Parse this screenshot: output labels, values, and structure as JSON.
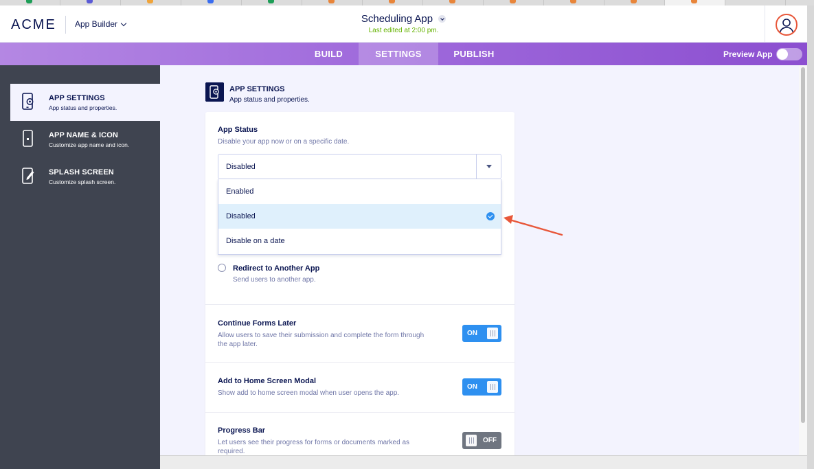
{
  "colors": {
    "navy": "#0a1551",
    "accent_blue": "#2e90f0",
    "edited_green": "#64b200",
    "nav_purple": "#a06bdc",
    "sidebar_bg": "#3f4450",
    "arrow_red": "#e8573a"
  },
  "header": {
    "logo": "ACME",
    "app_builder_label": "App Builder",
    "app_title": "Scheduling App",
    "last_edited": "Last edited at 2:00 pm.",
    "avatar_icon": "user-avatar-icon"
  },
  "nav": {
    "tabs": [
      {
        "label": "BUILD",
        "active": false
      },
      {
        "label": "SETTINGS",
        "active": true
      },
      {
        "label": "PUBLISH",
        "active": false
      }
    ],
    "preview_label": "Preview App",
    "preview_on": false
  },
  "sidebar": {
    "items": [
      {
        "label": "APP SETTINGS",
        "sub": "App status and properties.",
        "icon": "phone-gear-icon",
        "active": true
      },
      {
        "label": "APP NAME & ICON",
        "sub": "Customize app name and icon.",
        "icon": "phone-icon",
        "active": false
      },
      {
        "label": "SPLASH SCREEN",
        "sub": "Customize splash screen.",
        "icon": "edit-screen-icon",
        "active": false
      }
    ]
  },
  "section": {
    "title": "APP SETTINGS",
    "subtitle": "App status and properties.",
    "icon": "phone-gear-icon"
  },
  "app_status": {
    "title": "App Status",
    "subtitle": "Disable your app now or on a specific date.",
    "selected": "Disabled",
    "options": [
      {
        "label": "Enabled",
        "selected": false
      },
      {
        "label": "Disabled",
        "selected": true
      },
      {
        "label": "Disable on a date",
        "selected": false
      }
    ]
  },
  "redirect": {
    "title": "Redirect to Another App",
    "subtitle": "Send users to another app.",
    "checked": false
  },
  "settings": [
    {
      "title": "Continue Forms Later",
      "subtitle": "Allow users to save their submission and complete the form through the app later.",
      "state": "ON"
    },
    {
      "title": "Add to Home Screen Modal",
      "subtitle": "Show add to home screen modal when user opens the app.",
      "state": "ON"
    },
    {
      "title": "Progress Bar",
      "subtitle": "Let users see their progress for forms or documents marked as required.",
      "state": "OFF"
    }
  ]
}
